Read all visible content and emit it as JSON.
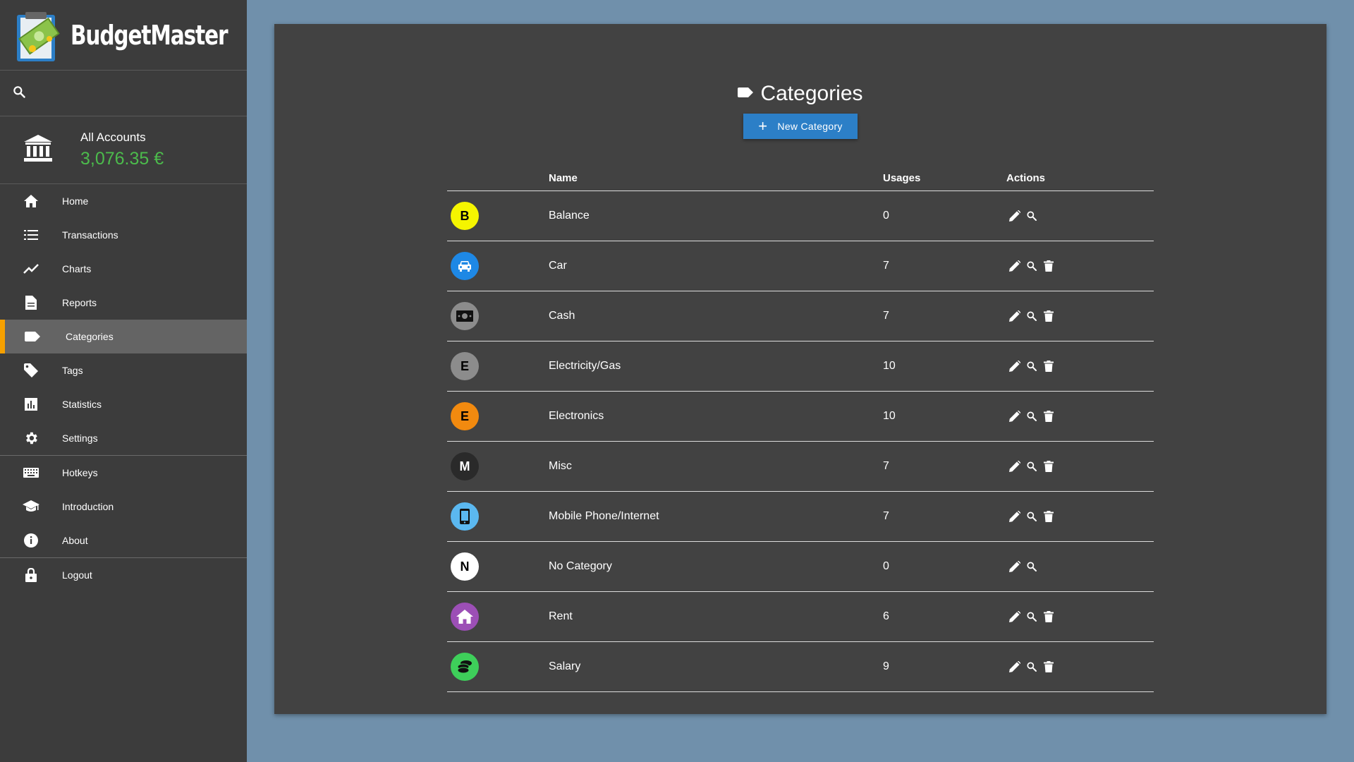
{
  "app": {
    "name": "BudgetMaster"
  },
  "account": {
    "name": "All Accounts",
    "balance": "3,076.35 €",
    "balance_color": "#4cbb4c"
  },
  "nav": [
    {
      "label": "Home",
      "icon": "home-icon"
    },
    {
      "label": "Transactions",
      "icon": "list-icon"
    },
    {
      "label": "Charts",
      "icon": "chart-line-icon"
    },
    {
      "label": "Reports",
      "icon": "document-icon"
    },
    {
      "label": "Categories",
      "icon": "label-icon",
      "active": true
    },
    {
      "label": "Tags",
      "icon": "tag-icon"
    },
    {
      "label": "Statistics",
      "icon": "bar-chart-icon"
    },
    {
      "label": "Settings",
      "icon": "gear-icon"
    },
    {
      "label": "Hotkeys",
      "icon": "keyboard-icon"
    },
    {
      "label": "Introduction",
      "icon": "graduation-cap-icon"
    },
    {
      "label": "About",
      "icon": "info-icon"
    },
    {
      "label": "Logout",
      "icon": "lock-icon"
    }
  ],
  "page": {
    "title": "Categories",
    "new_button": "New Category"
  },
  "table": {
    "headers": {
      "name": "Name",
      "usages": "Usages",
      "actions": "Actions"
    },
    "rows": [
      {
        "name": "Balance",
        "usages": "0",
        "letter": "B",
        "bg": "#f5f500",
        "fg": "#000000",
        "deletable": false
      },
      {
        "name": "Car",
        "usages": "7",
        "icon": "car-icon",
        "bg": "#1e88e5",
        "fg": "#ffffff",
        "deletable": true
      },
      {
        "name": "Cash",
        "usages": "7",
        "icon": "money-icon",
        "bg": "#8c8c8c",
        "fg": "#000000",
        "deletable": true
      },
      {
        "name": "Electricity/Gas",
        "usages": "10",
        "letter": "E",
        "bg": "#8c8c8c",
        "fg": "#000000",
        "deletable": true
      },
      {
        "name": "Electronics",
        "usages": "10",
        "letter": "E",
        "bg": "#f28a0f",
        "fg": "#000000",
        "deletable": true
      },
      {
        "name": "Misc",
        "usages": "7",
        "letter": "M",
        "bg": "#2a2a2a",
        "fg": "#ffffff",
        "deletable": true
      },
      {
        "name": "Mobile Phone/Internet",
        "usages": "7",
        "icon": "phone-icon",
        "bg": "#5bb8f0",
        "fg": "#000000",
        "deletable": true
      },
      {
        "name": "No Category",
        "usages": "0",
        "letter": "N",
        "bg": "#ffffff",
        "fg": "#000000",
        "deletable": false
      },
      {
        "name": "Rent",
        "usages": "6",
        "icon": "house-icon",
        "bg": "#9c4fb6",
        "fg": "#ffffff",
        "deletable": true
      },
      {
        "name": "Salary",
        "usages": "9",
        "icon": "coins-icon",
        "bg": "#3ecf5a",
        "fg": "#000000",
        "deletable": true
      }
    ]
  }
}
